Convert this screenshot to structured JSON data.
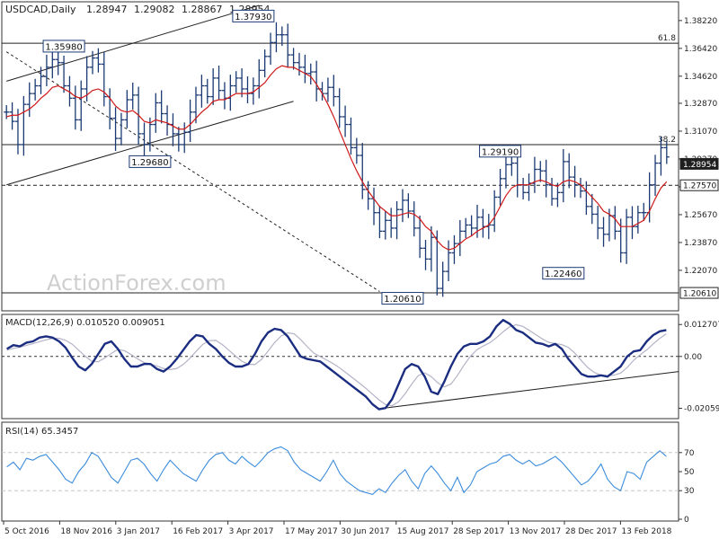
{
  "chart_data": [
    {
      "type": "ohlc",
      "panel": "price",
      "symbol": "USDCAD",
      "timeframe": "Daily",
      "header_ohlc": [
        "1.28947",
        "1.29082",
        "1.28867",
        "1.28954"
      ],
      "ylim": [
        1.198,
        1.392
      ],
      "y_ticks": [
        1.3822,
        1.3642,
        1.3462,
        1.3287,
        1.3107,
        1.2927,
        1.2747,
        1.2567,
        1.2387,
        1.2207
      ],
      "y_tick_labels": [
        "1.38220",
        "1.36420",
        "1.34620",
        "1.32870",
        "1.31070",
        "1.29270",
        "1.27470",
        "1.25670",
        "1.23870",
        "1.22070"
      ],
      "x_tick_labels": [
        "5 Oct 2016",
        "18 Nov 2016",
        "3 Jan 2017",
        "16 Feb 2017",
        "3 Apr 2017",
        "17 May 2017",
        "30 Jun 2017",
        "15 Aug 2017",
        "28 Sep 2017",
        "13 Nov 2017",
        "28 Dec 2017",
        "13 Feb 2018"
      ],
      "closes": [
        1.323,
        1.317,
        1.302,
        1.328,
        1.335,
        1.34,
        1.346,
        1.352,
        1.357,
        1.355,
        1.34,
        1.332,
        1.318,
        1.338,
        1.352,
        1.358,
        1.354,
        1.333,
        1.319,
        1.306,
        1.318,
        1.331,
        1.334,
        1.309,
        1.302,
        1.315,
        1.329,
        1.322,
        1.315,
        1.309,
        1.302,
        1.31,
        1.323,
        1.334,
        1.34,
        1.333,
        1.345,
        1.337,
        1.332,
        1.34,
        1.345,
        1.338,
        1.335,
        1.34,
        1.35,
        1.359,
        1.368,
        1.373,
        1.373,
        1.36,
        1.355,
        1.352,
        1.348,
        1.349,
        1.338,
        1.335,
        1.339,
        1.333,
        1.32,
        1.315,
        1.3,
        1.295,
        1.273,
        1.267,
        1.258,
        1.246,
        1.253,
        1.248,
        1.26,
        1.266,
        1.259,
        1.248,
        1.235,
        1.228,
        1.242,
        1.209,
        1.22,
        1.232,
        1.238,
        1.246,
        1.25,
        1.248,
        1.255,
        1.249,
        1.25,
        1.268,
        1.28,
        1.289,
        1.29,
        1.276,
        1.271,
        1.277,
        1.286,
        1.285,
        1.276,
        1.267,
        1.271,
        1.291,
        1.281,
        1.276,
        1.272,
        1.262,
        1.257,
        1.248,
        1.244,
        1.256,
        1.246,
        1.232,
        1.255,
        1.249,
        1.258,
        1.258,
        1.276,
        1.29,
        1.3,
        1.294
      ],
      "ma": [
        1.32,
        1.321,
        1.321,
        1.323,
        1.325,
        1.328,
        1.332,
        1.335,
        1.339,
        1.34,
        1.338,
        1.336,
        1.333,
        1.332,
        1.334,
        1.337,
        1.338,
        1.336,
        1.332,
        1.327,
        1.324,
        1.323,
        1.324,
        1.321,
        1.317,
        1.316,
        1.318,
        1.317,
        1.316,
        1.314,
        1.312,
        1.312,
        1.315,
        1.319,
        1.323,
        1.326,
        1.33,
        1.331,
        1.331,
        1.333,
        1.335,
        1.335,
        1.335,
        1.336,
        1.339,
        1.342,
        1.347,
        1.351,
        1.353,
        1.352,
        1.352,
        1.35,
        1.348,
        1.346,
        1.341,
        1.335,
        1.328,
        1.32,
        1.311,
        1.302,
        1.293,
        1.285,
        1.278,
        1.272,
        1.267,
        1.262,
        1.259,
        1.256,
        1.256,
        1.257,
        1.258,
        1.257,
        1.254,
        1.249,
        1.246,
        1.24,
        1.236,
        1.234,
        1.235,
        1.238,
        1.241,
        1.243,
        1.246,
        1.248,
        1.25,
        1.255,
        1.262,
        1.269,
        1.274,
        1.276,
        1.276,
        1.276,
        1.278,
        1.279,
        1.278,
        1.276,
        1.275,
        1.278,
        1.279,
        1.278,
        1.276,
        1.272,
        1.268,
        1.264,
        1.259,
        1.257,
        1.254,
        1.249,
        1.249,
        1.249,
        1.251,
        1.253,
        1.259,
        1.267,
        1.274,
        1.278
      ],
      "horizontal_levels": [
        1.3675,
        1.302,
        1.2757,
        1.2061
      ],
      "level_labels": [
        {
          "level": 1.3675,
          "label": "61.8"
        },
        {
          "level": 1.302,
          "label": "38.2"
        }
      ],
      "price_tags": [
        {
          "value": 1.28954,
          "label": "1.28954",
          "style": "dark"
        },
        {
          "value": 1.2757,
          "label": "1.27570",
          "style": "light"
        },
        {
          "value": 1.2061,
          "label": "1.20610",
          "style": "light"
        }
      ],
      "pivot_labels": [
        {
          "value": 1.3793,
          "label": "1.37930"
        },
        {
          "value": 1.3598,
          "label": "1.35980"
        },
        {
          "value": 1.2968,
          "label": "1.29680"
        },
        {
          "value": 1.2919,
          "label": "1.29190"
        },
        {
          "value": 1.2246,
          "label": "1.22460"
        },
        {
          "value": 1.2061,
          "label": "1.20610"
        }
      ],
      "trend_lines": [
        {
          "from": {
            "bar": 0,
            "price": 1.343
          },
          "to": {
            "bar": 44,
            "price": 1.392
          },
          "style": "solid"
        },
        {
          "from": {
            "bar": 0,
            "price": 1.276
          },
          "to": {
            "bar": 50,
            "price": 1.33
          },
          "style": "solid"
        },
        {
          "from": {
            "bar": 0,
            "price": 1.362
          },
          "to": {
            "bar": 65,
            "price": 1.207
          },
          "style": "dashed"
        }
      ],
      "watermark": "ActionForex.com"
    },
    {
      "type": "line",
      "panel": "macd",
      "title": "MACD(12,26,9) 0.010520 0.009051",
      "ylim": [
        -0.024,
        0.016
      ],
      "y_ticks": [
        0.012707,
        0.0,
        -0.020599
      ],
      "y_tick_labels": [
        "0.012707",
        "0.00",
        "-0.020599"
      ],
      "series": [
        {
          "values": [
            0.003,
            0.0045,
            0.004,
            0.0055,
            0.006,
            0.0075,
            0.008,
            0.0075,
            0.006,
            0.0035,
            -0.0005,
            -0.004,
            -0.0055,
            -0.003,
            0.001,
            0.005,
            0.006,
            0.003,
            -0.001,
            -0.004,
            -0.004,
            -0.003,
            -0.003,
            -0.005,
            -0.006,
            -0.004,
            -0.001,
            0.0025,
            0.006,
            0.0085,
            0.008,
            0.005,
            0.003,
            0.0,
            -0.0025,
            -0.004,
            -0.004,
            -0.003,
            0.001,
            0.006,
            0.0095,
            0.011,
            0.0105,
            0.008,
            0.004,
            0.0,
            -0.001,
            -0.0015,
            -0.002,
            -0.004,
            -0.006,
            -0.008,
            -0.01,
            -0.012,
            -0.014,
            -0.016,
            -0.019,
            -0.021,
            -0.0205,
            -0.017,
            -0.011,
            -0.005,
            -0.003,
            -0.004,
            -0.008,
            -0.014,
            -0.015,
            -0.01,
            -0.004,
            0.001,
            0.004,
            0.005,
            0.005,
            0.006,
            0.008,
            0.012,
            0.0145,
            0.013,
            0.0105,
            0.0095,
            0.0075,
            0.0055,
            0.005,
            0.004,
            0.005,
            0.003,
            -0.001,
            -0.004,
            -0.007,
            -0.008,
            -0.008,
            -0.0075,
            -0.008,
            -0.006,
            -0.004,
            0.0,
            0.002,
            0.0025,
            0.006,
            0.0085,
            0.01,
            0.0105
          ]
        },
        {
          "values": [
            0.0025,
            0.0032,
            0.0037,
            0.0044,
            0.0051,
            0.0059,
            0.0066,
            0.0072,
            0.0072,
            0.0064,
            0.0049,
            0.0025,
            0.0001,
            -0.0019,
            -0.0021,
            -0.0006,
            0.0012,
            0.0028,
            0.0023,
            0.0008,
            -0.0009,
            -0.0024,
            -0.003,
            -0.0038,
            -0.0048,
            -0.0052,
            -0.0048,
            -0.0032,
            -0.0008,
            0.0021,
            0.0048,
            0.0063,
            0.0064,
            0.0047,
            0.0025,
            0.0002,
            -0.0019,
            -0.0031,
            -0.0032,
            -0.0012,
            0.0021,
            0.0055,
            0.0081,
            0.0094,
            0.009,
            0.0067,
            0.0039,
            0.0014,
            -0.0001,
            -0.0014,
            -0.0029,
            -0.0046,
            -0.0066,
            -0.0086,
            -0.0106,
            -0.0127,
            -0.015,
            -0.0173,
            -0.0191,
            -0.0196,
            -0.018,
            -0.0148,
            -0.011,
            -0.0076,
            -0.0065,
            -0.008,
            -0.0105,
            -0.0121,
            -0.011,
            -0.0076,
            -0.0035,
            0.0001,
            0.0027,
            0.0042,
            0.0055,
            0.0075,
            0.0098,
            0.0118,
            0.0126,
            0.012,
            0.0104,
            0.0087,
            0.007,
            0.0056,
            0.0051,
            0.0047,
            0.0036,
            0.0013,
            -0.0017,
            -0.0045,
            -0.0064,
            -0.0074,
            -0.0077,
            -0.0074,
            -0.0066,
            -0.0044,
            -0.0015,
            0.0007,
            0.0026,
            0.005,
            0.0072,
            0.009
          ]
        }
      ],
      "trend_lines": [
        {
          "from": {
            "bar": 57,
            "value": -0.0208
          },
          "to": {
            "bar": 101,
            "value": -0.006
          },
          "style": "solid"
        }
      ]
    },
    {
      "type": "line",
      "panel": "rsi",
      "title": "RSI(14) 65.3457",
      "ylim": [
        0,
        100
      ],
      "y_ticks": [
        70,
        50,
        30,
        0
      ],
      "y_tick_labels": [
        "70",
        "50",
        "30",
        "0"
      ],
      "guide_levels": [
        70,
        30
      ],
      "series": [
        {
          "values": [
            55,
            60,
            52,
            64,
            62,
            66,
            68,
            60,
            52,
            42,
            38,
            50,
            58,
            70,
            66,
            55,
            44,
            38,
            50,
            62,
            64,
            58,
            48,
            40,
            52,
            62,
            55,
            48,
            44,
            40,
            52,
            62,
            68,
            70,
            62,
            58,
            66,
            60,
            55,
            62,
            70,
            74,
            76,
            72,
            60,
            52,
            48,
            44,
            40,
            50,
            62,
            48,
            40,
            35,
            30,
            28,
            26,
            32,
            28,
            38,
            46,
            52,
            40,
            32,
            48,
            56,
            48,
            38,
            30,
            44,
            28,
            36,
            50,
            54,
            58,
            60,
            66,
            68,
            62,
            58,
            62,
            56,
            58,
            62,
            66,
            60,
            52,
            44,
            36,
            40,
            48,
            58,
            42,
            34,
            30,
            50,
            48,
            42,
            60,
            66,
            72,
            66
          ]
        }
      ]
    }
  ],
  "colors": {
    "bars": "#1b3a73",
    "moving_average": "#d01818",
    "macd_line": "#1b2d80",
    "signal_line": "#b4b4c8",
    "rsi_line": "#3c8cdc",
    "grid_dots": "#c6c6c6",
    "watermark": "#cfcfcf"
  }
}
